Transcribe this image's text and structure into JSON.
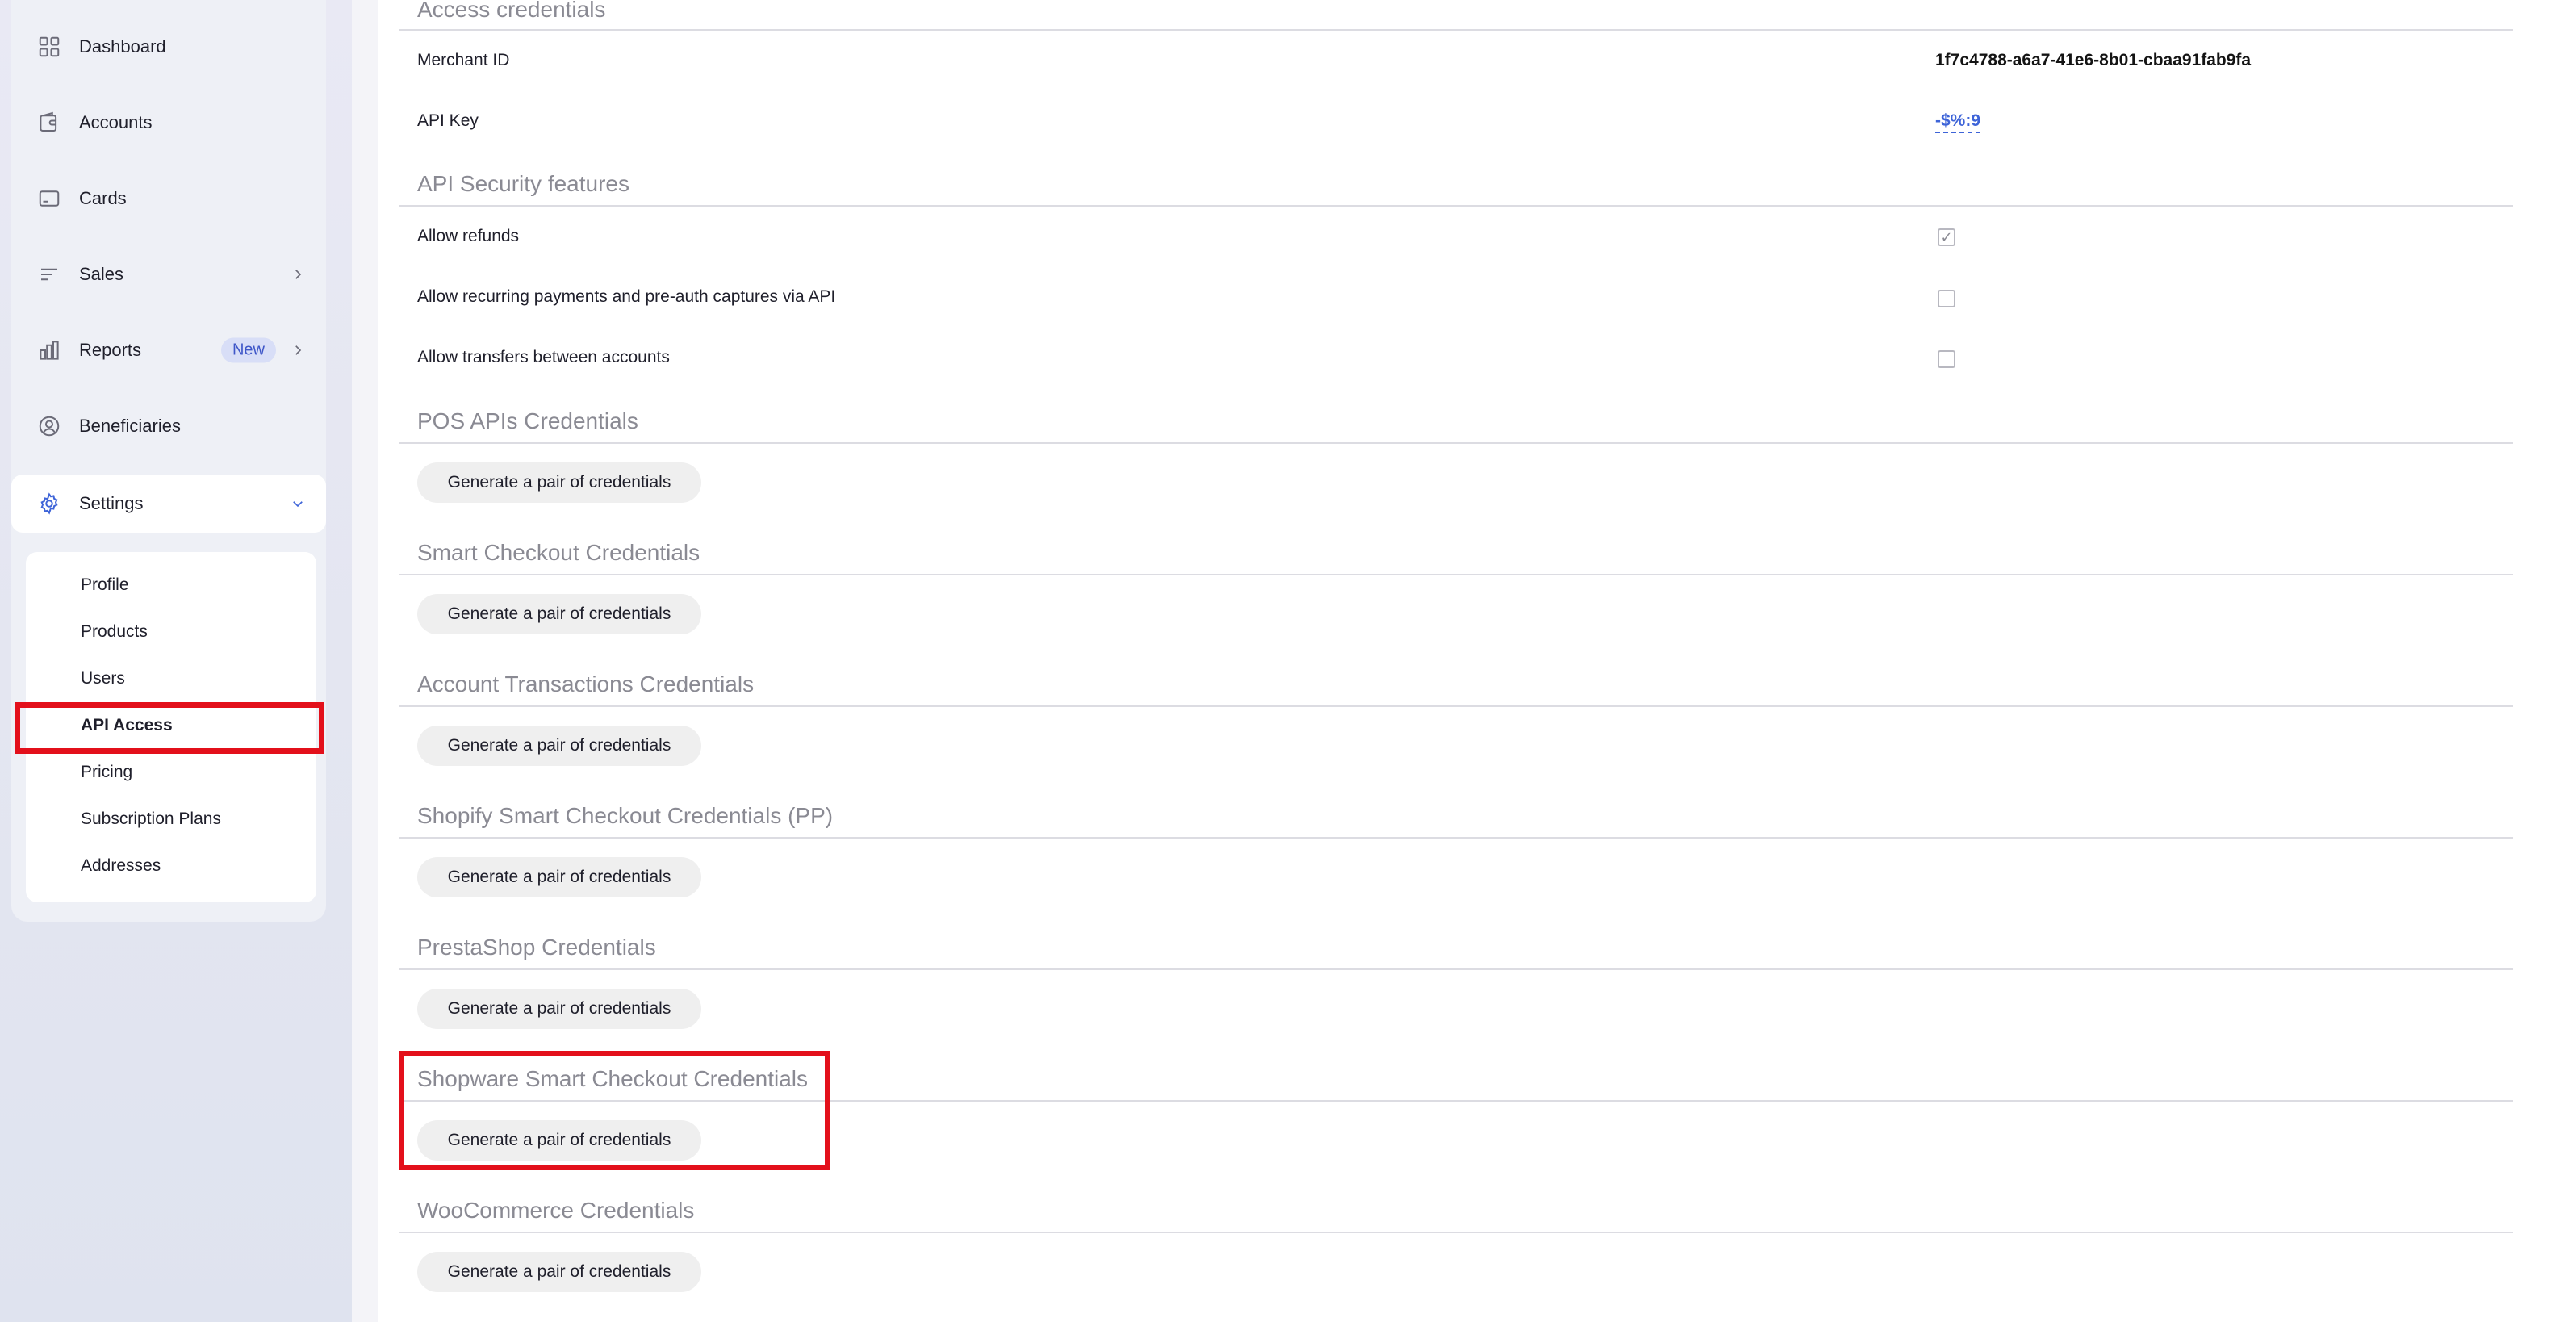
{
  "sidebar": {
    "items": [
      {
        "label": "Dashboard",
        "icon": "grid-icon"
      },
      {
        "label": "Accounts",
        "icon": "wallet-icon"
      },
      {
        "label": "Cards",
        "icon": "card-icon"
      },
      {
        "label": "Sales",
        "icon": "list-icon"
      },
      {
        "label": "Reports",
        "icon": "bar-chart-icon",
        "badge": "New"
      },
      {
        "label": "Beneficiaries",
        "icon": "user-circle-icon"
      },
      {
        "label": "Settings",
        "icon": "gear-icon"
      }
    ],
    "settings_subitems": [
      {
        "label": "Profile"
      },
      {
        "label": "Products"
      },
      {
        "label": "Users"
      },
      {
        "label": "API Access",
        "active": true
      },
      {
        "label": "Pricing"
      },
      {
        "label": "Subscription Plans"
      },
      {
        "label": "Addresses"
      }
    ]
  },
  "main": {
    "access_credentials": {
      "title": "Access credentials",
      "merchant_id_label": "Merchant ID",
      "merchant_id_value": "1f7c4788-a6a7-41e6-8b01-cbaa91fab9fa",
      "api_key_label": "API Key",
      "api_key_value": "-$%:9"
    },
    "security_features": {
      "title": "API Security features",
      "items": [
        {
          "label": "Allow refunds",
          "checked": true
        },
        {
          "label": "Allow recurring payments and pre-auth captures via API",
          "checked": false
        },
        {
          "label": "Allow transfers between accounts",
          "checked": false
        }
      ]
    },
    "credential_sections": [
      {
        "title": "POS APIs Credentials",
        "button": "Generate a pair of credentials"
      },
      {
        "title": "Smart Checkout Credentials",
        "button": "Generate a pair of credentials"
      },
      {
        "title": "Account Transactions Credentials",
        "button": "Generate a pair of credentials"
      },
      {
        "title": "Shopify Smart Checkout Credentials (PP)",
        "button": "Generate a pair of credentials"
      },
      {
        "title": "PrestaShop Credentials",
        "button": "Generate a pair of credentials"
      },
      {
        "title": "Shopware Smart Checkout Credentials",
        "button": "Generate a pair of credentials"
      },
      {
        "title": "WooCommerce Credentials",
        "button": "Generate a pair of credentials"
      }
    ]
  },
  "colors": {
    "highlight": "#e3101b",
    "accent_blue": "#3e64d8",
    "badge_bg": "#d8def7"
  }
}
